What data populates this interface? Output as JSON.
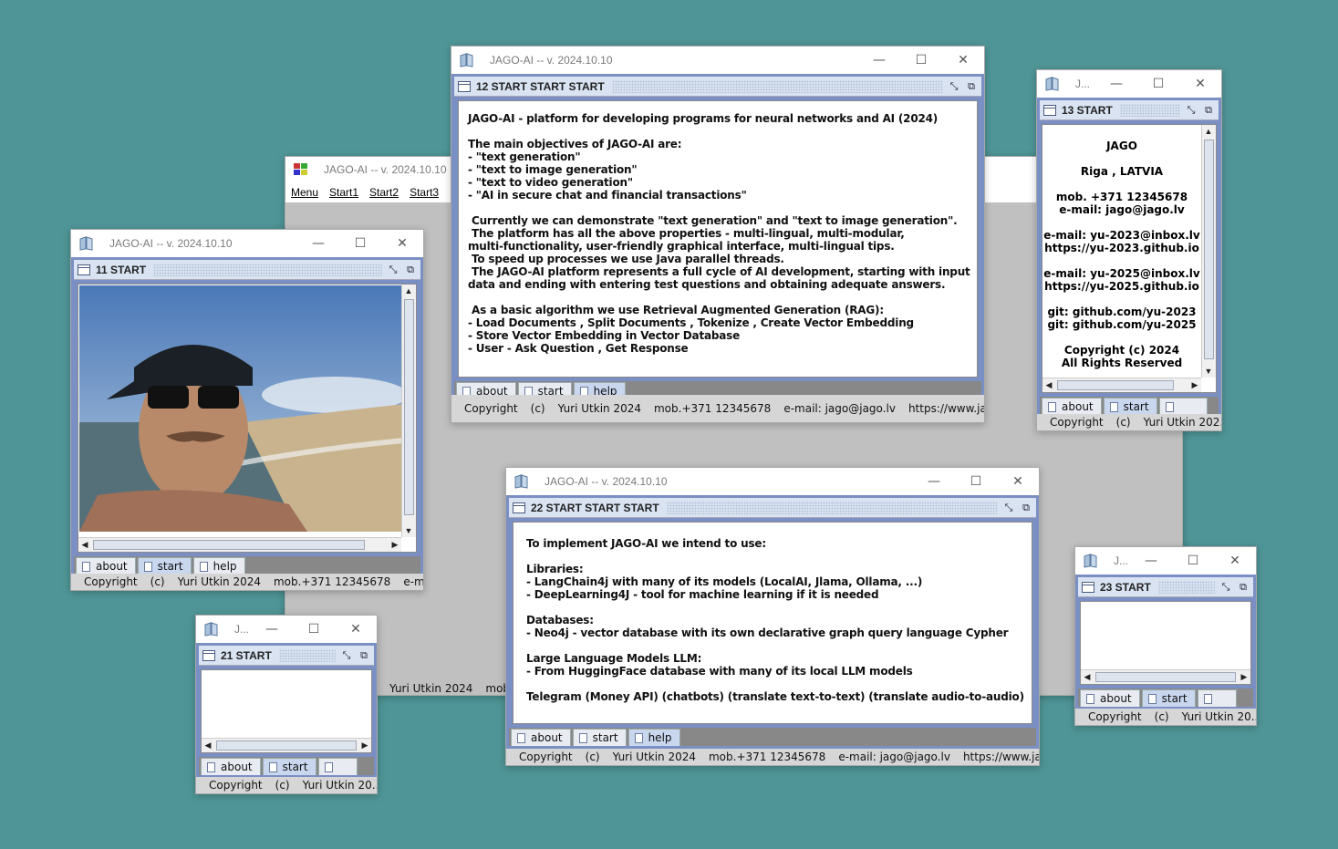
{
  "app_title": "JAGO-AI -- v. 2024.10.10",
  "app_title_short": "J...",
  "background_color": "#4f9597",
  "controls": {
    "minimize": "—",
    "maximize": "☐",
    "close": "✕"
  },
  "tabs": {
    "about": "about",
    "start": "start",
    "help": "help"
  },
  "status": {
    "copyright": "Copyright",
    "c": "(c)",
    "author": "Yuri Utkin 2024",
    "author_short": "Yuri Utkin 20...",
    "author_short2": "Yuri Utkin 202...",
    "mob": "mob.+371 12345678",
    "email": "e-mail: jago@jago.lv",
    "email_short": "e-mai...",
    "web": "https://www.jago.lv"
  },
  "main_window": {
    "menu": [
      "Menu",
      "Start1",
      "Start2",
      "Start3"
    ],
    "status_author": "Yuri Utkin 2024",
    "status_mob": "mob."
  },
  "win11": {
    "inner_title": "11 START"
  },
  "win12": {
    "inner_title": "12 START START START",
    "text": "JAGO-AI - platform for developing programs for neural networks and AI (2024)\n\nThe main objectives of JAGO-AI are:\n- \"text generation\"\n- \"text to image generation\"\n- \"text to video generation\"\n- \"AI in secure chat and financial transactions\"\n\n Currently we can demonstrate \"text generation\" and \"text to image generation\".\n The platform has all the above properties - multi-lingual, multi-modular,\nmulti-functionality, user-friendly graphical interface, multi-lingual tips.\n To speed up processes we use Java parallel threads.\n The JAGO-AI platform represents a full cycle of AI development, starting with input\ndata and ending with entering test questions and obtaining adequate answers.\n\n As a basic algorithm we use Retrieval Augmented Generation (RAG):\n- Load Documents , Split Documents , Tokenize , Create Vector Embedding\n- Store Vector Embedding in Vector Database\n- User - Ask Question , Get Response"
  },
  "win13": {
    "inner_title": "13 START",
    "lines": [
      "JAGO",
      "",
      "Riga , LATVIA",
      "",
      "mob. +371 12345678",
      "e-mail: jago@jago.lv",
      "",
      "e-mail: yu-2023@inbox.lv",
      "https://yu-2023.github.io",
      "",
      "e-mail: yu-2025@inbox.lv",
      "https://yu-2025.github.io",
      "",
      "git: github.com/yu-2023",
      "git: github.com/yu-2025",
      "",
      "Copyright (c) 2024",
      "All Rights Reserved"
    ]
  },
  "win21": {
    "inner_title": "21 START"
  },
  "win22": {
    "inner_title": "22 START START START",
    "text": "To implement JAGO-AI we intend to use:\n\nLibraries:\n- LangChain4j with many of its models (LocalAI, Jlama, Ollama, ...)\n- DeepLearning4J - tool for machine learning if it is needed\n\nDatabases:\n- Neo4j - vector database with its own declarative graph query language Cypher\n\nLarge Language Models LLM:\n- From HuggingFace database with many of its local LLM models\n\nTelegram (Money API) (chatbots) (translate text-to-text) (translate audio-to-audio)"
  },
  "win23": {
    "inner_title": "23 START"
  }
}
